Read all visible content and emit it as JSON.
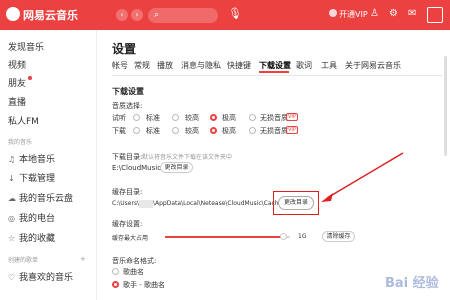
{
  "titlebar": {
    "app_name": "网易云音乐",
    "back_icon": "‹",
    "forward_icon": "›",
    "search_icon": "⌕",
    "mic_icon": "🎙",
    "vip_label": "开通VIP",
    "icons": [
      "shirt-icon",
      "gear-icon",
      "mail-icon"
    ]
  },
  "sidebar": {
    "top_items": [
      "发现音乐",
      "视频",
      "朋友",
      "直播",
      "私人FM"
    ],
    "section_my": "我的音乐",
    "my_items": [
      {
        "icon": "♫",
        "label": "本地音乐"
      },
      {
        "icon": "↓",
        "label": "下载管理"
      },
      {
        "icon": "☁",
        "label": "我的音乐云盘"
      },
      {
        "icon": "◎",
        "label": "我的电台"
      },
      {
        "icon": "☆",
        "label": "我的收藏"
      }
    ],
    "section_created": "创建的歌单",
    "created_items": [
      {
        "icon": "♡",
        "label": "我喜欢的音乐"
      }
    ]
  },
  "settings": {
    "title": "设置",
    "tabs": [
      "帐号",
      "常规",
      "播放",
      "消息与隐私",
      "快捷键",
      "下载设置",
      "歌词",
      "工具",
      "关于网易云音乐"
    ],
    "active_tab": "下载设置",
    "section_download": "下载设置",
    "quality_label": "音质选择:",
    "quality_rows": [
      {
        "label": "试听",
        "options": [
          "标准",
          "较高",
          "极高",
          "无损音质"
        ],
        "selected": 2
      },
      {
        "label": "下载",
        "options": [
          "标准",
          "较高",
          "极高",
          "无损音质"
        ],
        "selected": 2
      }
    ],
    "vip_tag": "VIP",
    "download_dir_label": "下载目录:",
    "download_dir_hint": "默认将音乐文件下载在该文件夹中",
    "download_dir_path": "E:\\CloudMusic",
    "change_dir_button": "更改目录",
    "cache_dir_label": "缓存目录:",
    "cache_dir_path_a": "C:\\Users\\",
    "cache_dir_path_b": "\\AppData\\Local\\Netease\\CloudMusic\\Cache",
    "cache_change_button": "更改目录",
    "cache_setting_label": "缓存设置:",
    "cache_max_label": "缓存最大占用",
    "cache_max_value": "1G",
    "cache_max_fraction": 0.95,
    "clear_cache_button": "清除缓存",
    "naming_label": "音乐命名格式:",
    "naming_options": [
      "歌曲名",
      "歌手 - 歌曲名"
    ],
    "naming_selected": 1,
    "watermark": "Bai 经验"
  },
  "colors": {
    "brand": "#ec4141",
    "annotation": "#e02020"
  }
}
